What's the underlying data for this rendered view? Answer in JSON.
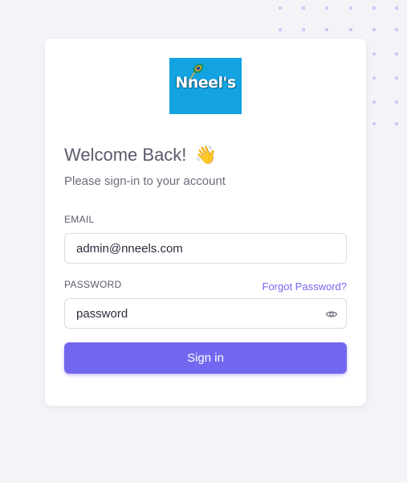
{
  "brand": {
    "logo_text": "Nneel's",
    "logo_bg": "#12a3e0"
  },
  "login": {
    "title": "Welcome Back!",
    "wave_emoji": "👋",
    "subtitle": "Please sign-in to your account",
    "email_label": "EMAIL",
    "email_value": "admin@nneels.com",
    "password_label": "PASSWORD",
    "forgot_link": "Forgot Password?",
    "password_value": "password",
    "signin_label": "Sign in"
  },
  "icons": {
    "password_toggle": "eye-icon"
  },
  "colors": {
    "background": "#f4f4f8",
    "card": "#ffffff",
    "primary": "#7367f0",
    "heading": "#5d596c",
    "body_text": "#6f6b7d",
    "input_border": "#dbdade",
    "dots": "#cfcaf7"
  }
}
